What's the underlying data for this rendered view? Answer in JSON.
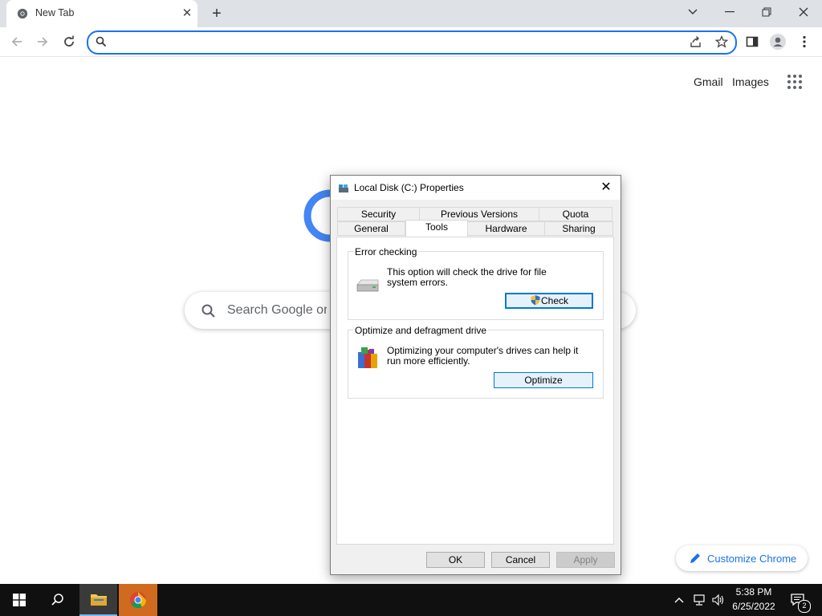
{
  "browser": {
    "tab_title": "New Tab",
    "omnibox_value": ""
  },
  "page": {
    "gmail_link": "Gmail",
    "images_link": "Images",
    "search_placeholder": "Search Google or type a URL",
    "customize_label": "Customize Chrome"
  },
  "dialog": {
    "title": "Local Disk (C:) Properties",
    "tabs_row1": [
      "Security",
      "Previous Versions",
      "Quota"
    ],
    "tabs_row2": [
      "General",
      "Tools",
      "Hardware",
      "Sharing"
    ],
    "active_tab": "Tools",
    "error_checking": {
      "heading": "Error checking",
      "description": "This option will check the drive for file system errors.",
      "button": "Check"
    },
    "optimize": {
      "heading": "Optimize and defragment drive",
      "description": "Optimizing your computer's drives can help it run more efficiently.",
      "button": "Optimize"
    },
    "footer": {
      "ok": "OK",
      "cancel": "Cancel",
      "apply": "Apply"
    }
  },
  "taskbar": {
    "time": "5:38 PM",
    "date": "6/25/2022",
    "notification_count": "2"
  },
  "colors": {
    "accent": "#1a73e8",
    "focus_border": "#0078d7",
    "taskbar": "#101010"
  }
}
